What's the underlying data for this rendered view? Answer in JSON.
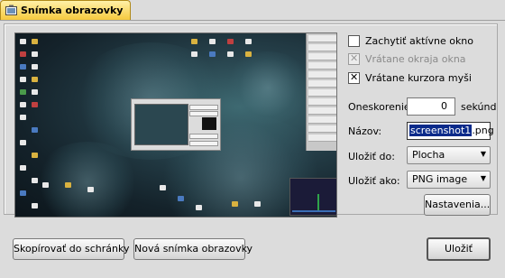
{
  "tab": {
    "title": "Snímka obrazovky"
  },
  "options": {
    "capture_active_window": {
      "label": "Zachytiť aktívne okno",
      "checked": false
    },
    "include_window_border": {
      "label": "Vrátane okraja okna",
      "checked": true,
      "disabled": true
    },
    "include_mouse_cursor": {
      "label": "Vrátane kurzora myši",
      "checked": true
    }
  },
  "delay": {
    "label": "Oneskorenie:",
    "value": "0",
    "unit": "sekúnd"
  },
  "filename": {
    "label": "Názov:",
    "selected_part": "screenshot1",
    "rest": ".png"
  },
  "save_to": {
    "label": "Uložiť do:",
    "value": "Plocha"
  },
  "save_as": {
    "label": "Uložiť ako:",
    "value": "PNG image"
  },
  "buttons": {
    "settings": "Nastavenia...",
    "copy_to_clipboard": "Skopírovať do schránky",
    "new_screenshot": "Nová snímka obrazovky",
    "save": "Uložiť"
  },
  "colors": {
    "tab_gold": "#f6c93e",
    "selection": "#0a2a8a",
    "panel": "#dcdcdc"
  }
}
